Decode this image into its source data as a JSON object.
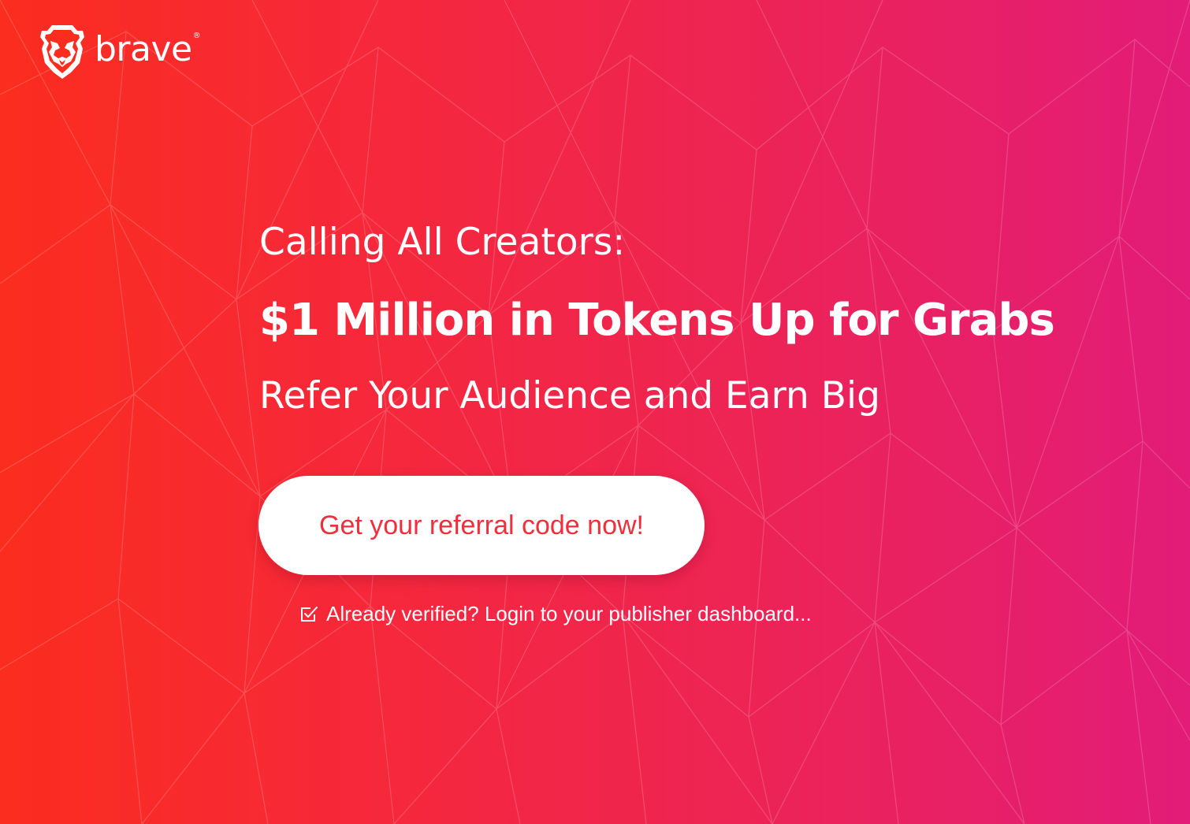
{
  "brand": {
    "name": "brave",
    "registered_mark": "®",
    "logo_icon": "brave-lion-icon"
  },
  "hero": {
    "subtitle": "Calling All Creators:",
    "headline": "$1 Million in Tokens Up for Grabs",
    "tagline": "Refer Your Audience and Earn Big"
  },
  "cta": {
    "label": "Get your referral code now!"
  },
  "login": {
    "icon": "checkbox-checked-icon",
    "label": "Already verified? Login to your publisher dashboard..."
  },
  "colors": {
    "gradient_start": "#fb2d1e",
    "gradient_end": "#e21c78",
    "cta_text": "#f02e3c",
    "cta_bg": "#ffffff"
  }
}
